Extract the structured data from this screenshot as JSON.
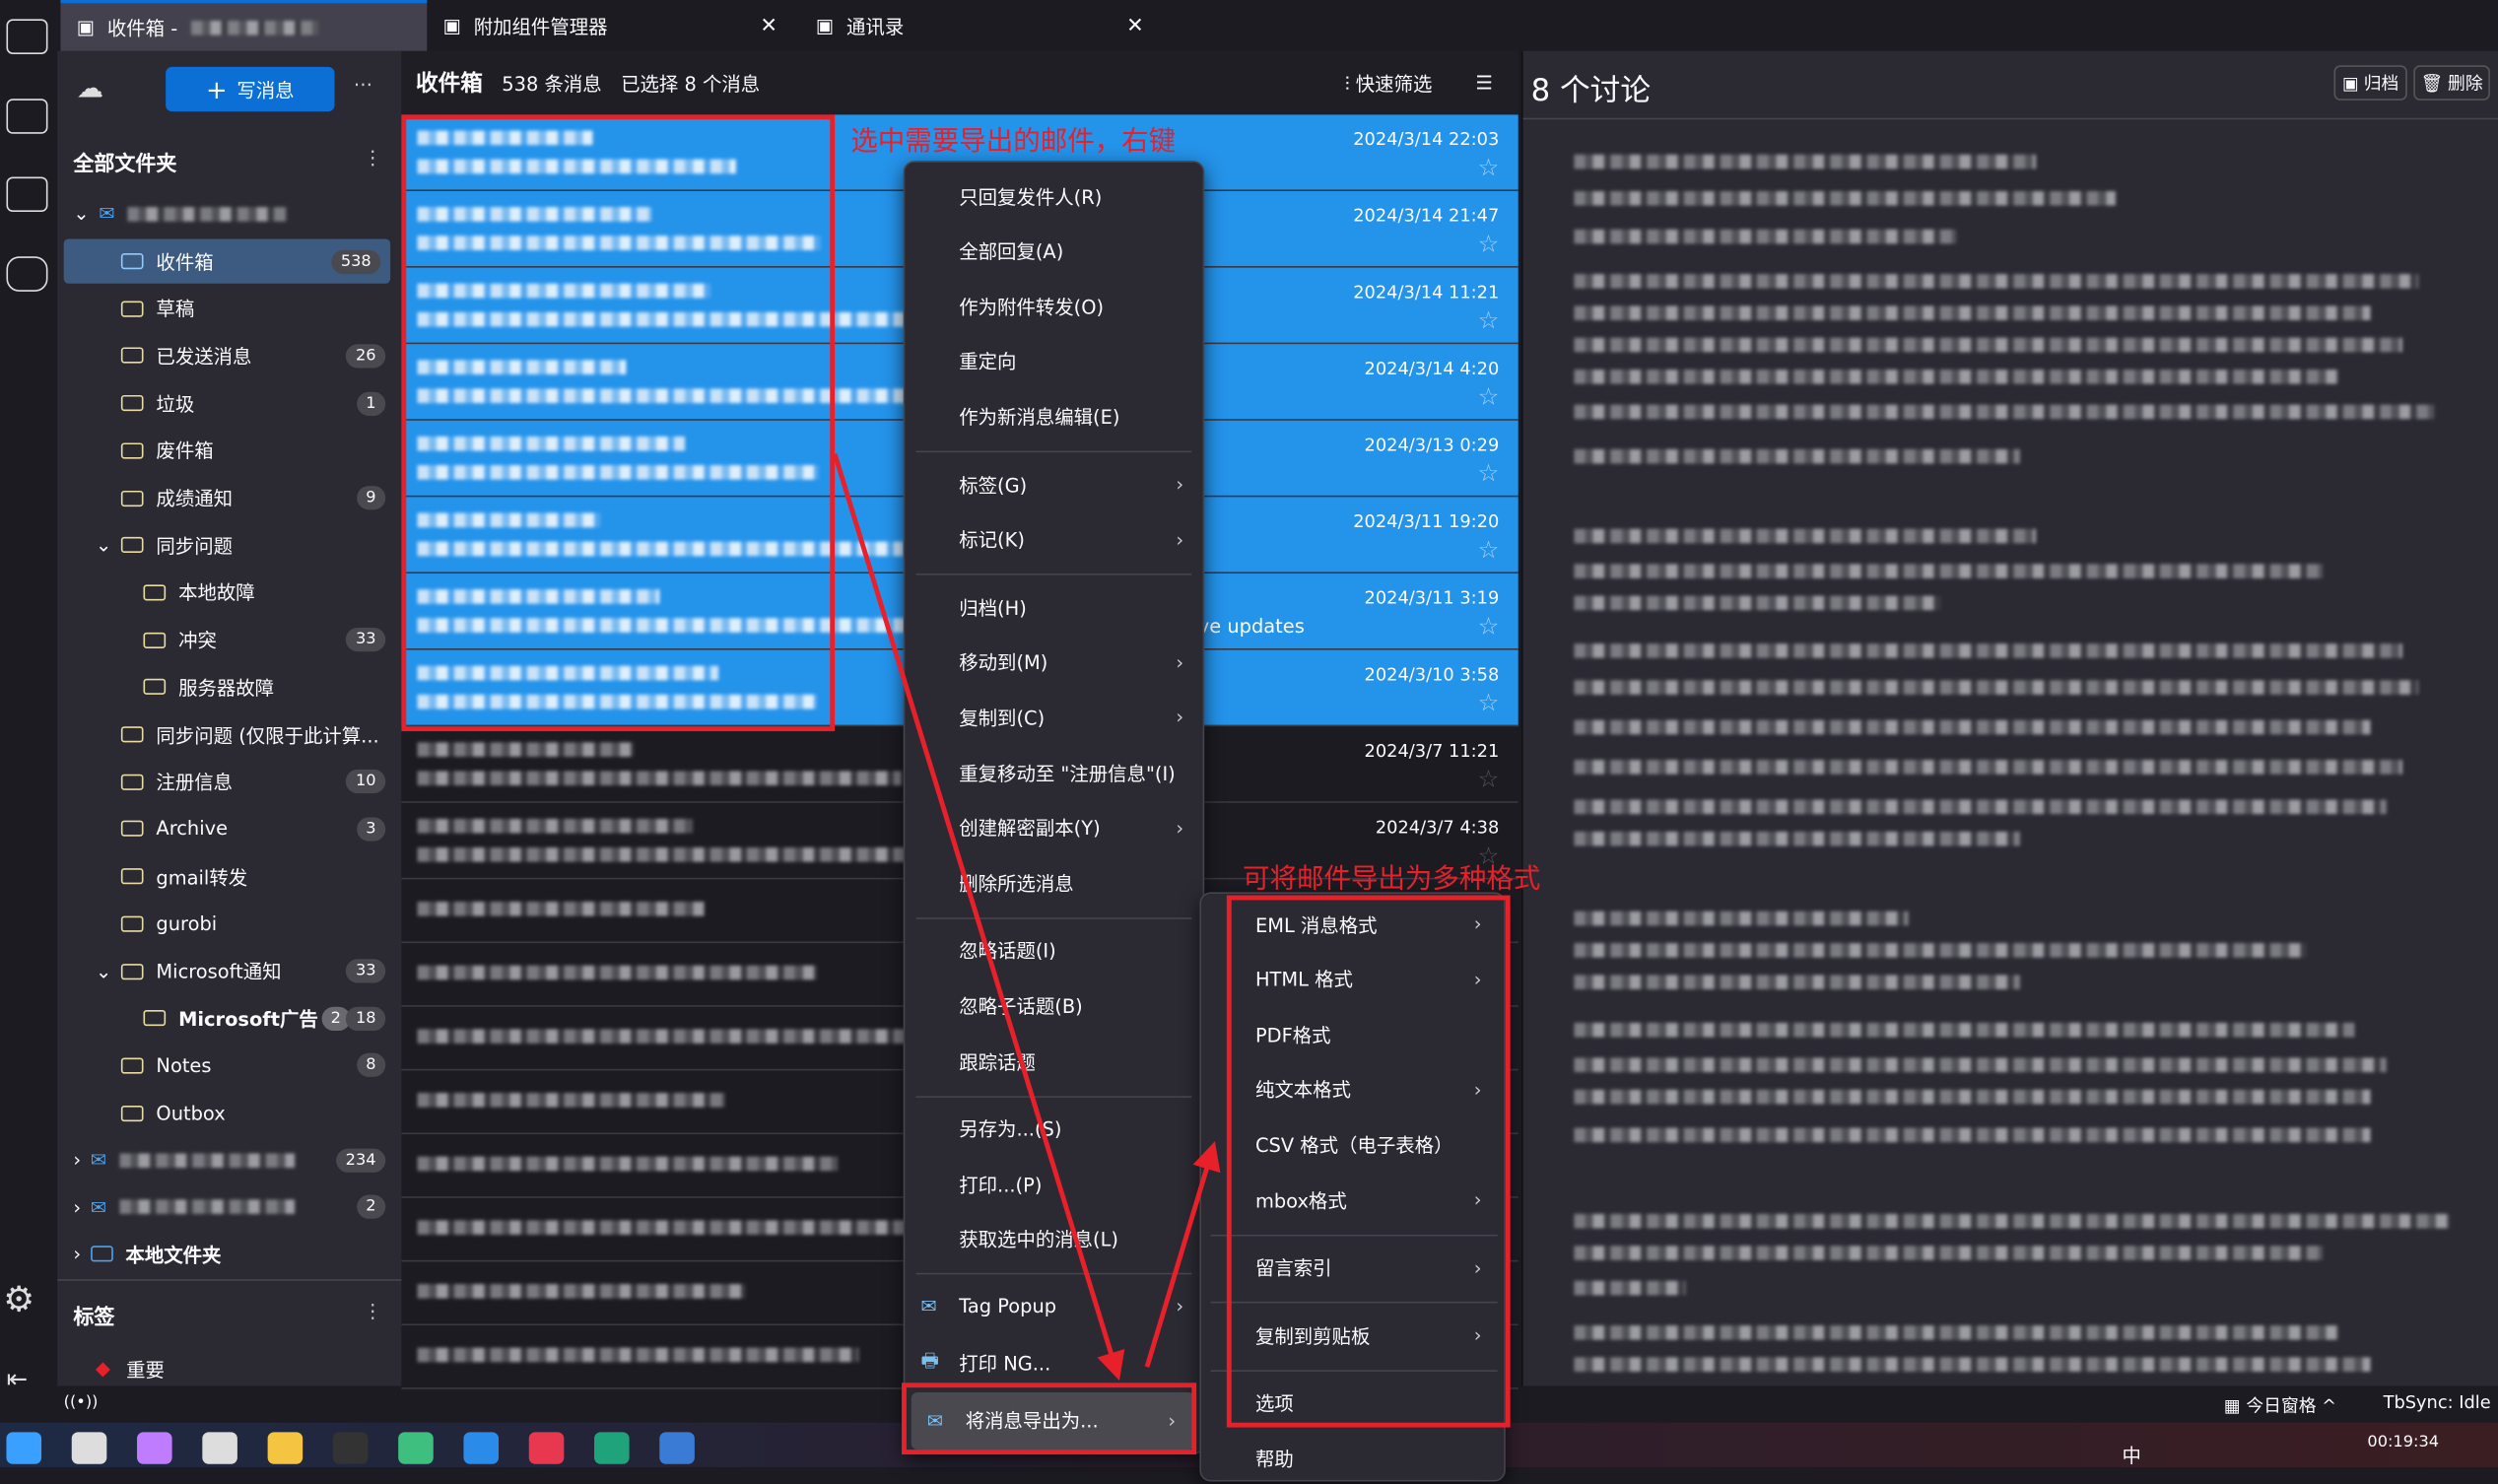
{
  "tabs": [
    {
      "label": "收件箱 - ",
      "icon": "inbox-icon",
      "active": true
    },
    {
      "label": "附加组件管理器",
      "icon": "puzzle-icon"
    },
    {
      "label": "通讯录",
      "icon": "address-book-icon"
    }
  ],
  "folder_pane": {
    "compose_label": "写消息",
    "all_folders": "全部文件夹",
    "tags_heading": "标签",
    "tag_items": [
      "重要"
    ],
    "folders": [
      {
        "name": "收件箱",
        "count": "538",
        "selected": true,
        "indent": 1,
        "icon": "inbox-icon"
      },
      {
        "name": "草稿",
        "indent": 1,
        "icon": "draft-icon"
      },
      {
        "name": "已发送消息",
        "count": "26",
        "indent": 1,
        "icon": "sent-icon"
      },
      {
        "name": "垃圾",
        "count": "1",
        "indent": 1,
        "icon": "junk-icon"
      },
      {
        "name": "废件箱",
        "indent": 1,
        "icon": "trash-icon"
      },
      {
        "name": "成绩通知",
        "count": "9",
        "indent": 1
      },
      {
        "name": "同步问题",
        "indent": 1,
        "expanded": true
      },
      {
        "name": "本地故障",
        "indent": 2
      },
      {
        "name": "冲突",
        "count": "33",
        "indent": 2
      },
      {
        "name": "服务器故障",
        "indent": 2
      },
      {
        "name": "同步问题 (仅限于此计算...",
        "indent": 1
      },
      {
        "name": "注册信息",
        "count": "10",
        "indent": 1
      },
      {
        "name": "Archive",
        "count": "3",
        "indent": 1
      },
      {
        "name": "gmail转发",
        "indent": 1
      },
      {
        "name": "gurobi",
        "indent": 1
      },
      {
        "name": "Microsoft通知",
        "count": "33",
        "indent": 1,
        "expanded": true
      },
      {
        "name": "Microsoft广告",
        "count": "18",
        "unread": "2",
        "indent": 2,
        "bold": true
      },
      {
        "name": "Notes",
        "count": "8",
        "indent": 1
      },
      {
        "name": "Outbox",
        "indent": 1
      }
    ],
    "accounts": [
      {
        "count": "234"
      },
      {
        "count": "2"
      }
    ],
    "local_folders": "本地文件夹"
  },
  "message_list": {
    "title": "收件箱",
    "count_text": "538 条消息",
    "selected_text": "已选择 8 个消息",
    "quick_filter": "快速筛选",
    "rows": [
      {
        "date": "2024/3/14 22:03",
        "selected": true
      },
      {
        "date": "2024/3/14 21:47",
        "selected": true
      },
      {
        "date": "2024/3/14 11:21",
        "selected": true
      },
      {
        "date": "2024/3/14 4:20",
        "selected": true
      },
      {
        "date": "2024/3/13 0:29",
        "selected": true
      },
      {
        "date": "2024/3/11 19:20",
        "selected": true
      },
      {
        "date": "2024/3/11 3:19",
        "selected": true,
        "subject_tail": "ve updates"
      },
      {
        "date": "2024/3/10 3:58",
        "selected": true
      },
      {
        "date": "2024/3/7 11:21"
      },
      {
        "date": "2024/3/7 4:38"
      }
    ]
  },
  "reader": {
    "title": "8 个讨论",
    "archive": "归档",
    "delete": "删除"
  },
  "context_menu": {
    "items": [
      {
        "label": "只回复发件人(R)"
      },
      {
        "label": "全部回复(A)"
      },
      {
        "label": "作为附件转发(O)"
      },
      {
        "label": "重定向"
      },
      {
        "label": "作为新消息编辑(E)",
        "sep_after": true
      },
      {
        "label": "标签(G)",
        "sub": true
      },
      {
        "label": "标记(K)",
        "sub": true,
        "sep_after": true
      },
      {
        "label": "归档(H)"
      },
      {
        "label": "移动到(M)",
        "sub": true
      },
      {
        "label": "复制到(C)",
        "sub": true
      },
      {
        "label": "重复移动至 \"注册信息\"(I)"
      },
      {
        "label": "创建解密副本(Y)",
        "sub": true
      },
      {
        "label": "删除所选消息",
        "sep_after": true
      },
      {
        "label": "忽略话题(I)"
      },
      {
        "label": "忽略子话题(B)"
      },
      {
        "label": "跟踪话题",
        "sep_after": true
      },
      {
        "label": "另存为...(S)"
      },
      {
        "label": "打印...(P)"
      },
      {
        "label": "获取选中的消息(L)",
        "sep_after": true
      },
      {
        "label": "Tag Popup",
        "sub": true,
        "icon": "tag-popup-icon"
      },
      {
        "label": "打印 NG...",
        "icon": "printer-icon"
      },
      {
        "label": "将消息导出为...",
        "sub": true,
        "icon": "export-mail-icon",
        "highlighted": true
      }
    ]
  },
  "export_submenu": {
    "items": [
      {
        "label": "EML 消息格式",
        "sub": true
      },
      {
        "label": "HTML 格式",
        "sub": true
      },
      {
        "label": "PDF格式"
      },
      {
        "label": "纯文本格式",
        "sub": true
      },
      {
        "label": "CSV 格式（电子表格）"
      },
      {
        "label": "mbox格式",
        "sub": true,
        "sep_after": true
      },
      {
        "label": "留言索引",
        "sub": true,
        "sep_after": true
      },
      {
        "label": "复制到剪贴板",
        "sub": true,
        "sep_after": true
      },
      {
        "label": "选项"
      },
      {
        "label": "帮助"
      }
    ]
  },
  "annotations": {
    "select_hint": "选中需要导出的邮件，右键",
    "export_hint": "可将邮件导出为多种格式",
    "color": "#e8202a"
  },
  "status_bar": {
    "today_pane": "今日窗格",
    "tbsync": "TbSync: Idle"
  },
  "taskbar": {
    "ime": "中",
    "time": "00:19:34"
  },
  "colors": {
    "accent": "#0b6fd6",
    "selection": "#2493ea",
    "annotation": "#e8202a"
  }
}
